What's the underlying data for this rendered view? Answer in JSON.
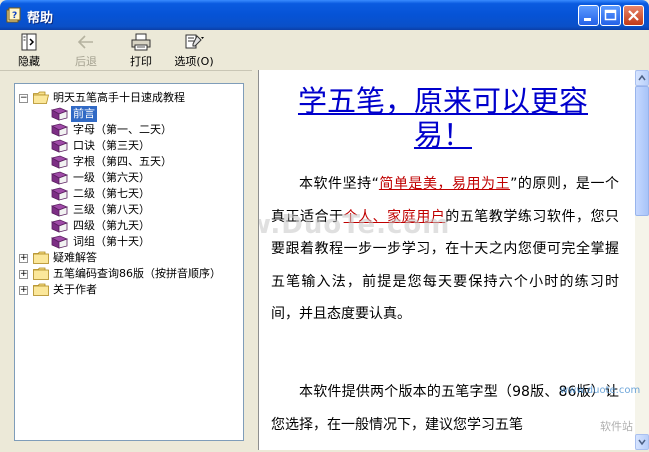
{
  "window": {
    "title": "帮助"
  },
  "toolbar": {
    "items": [
      {
        "label": "隐藏",
        "icon": "hide-pane-icon",
        "enabled": true
      },
      {
        "label": "后退",
        "icon": "back-arrow-icon",
        "enabled": false
      },
      {
        "label": "打印",
        "icon": "printer-icon",
        "enabled": true
      },
      {
        "label": "选项(O)",
        "icon": "options-icon",
        "enabled": true
      }
    ]
  },
  "tree": {
    "root": "明天五笔高手十日速成教程",
    "chapters": [
      "前言",
      "字母（第一、二天）",
      "口诀（第三天）",
      "字根（第四、五天）",
      "一级（第六天）",
      "二级（第七天）",
      "三级（第八天）",
      "四级（第九天）",
      "词组（第十天）"
    ],
    "selected": "前言",
    "others": [
      "疑难解答",
      "五笔编码查询86版（按拼音顺序）",
      "关于作者"
    ]
  },
  "content": {
    "heading_line1": "学五笔，原来可以更容",
    "heading_line2": "易！",
    "p1_a": "本软件坚持“",
    "p1_link1": "简单是美，易用为王",
    "p1_b": "”的原则，是一个真正适合于",
    "p1_link2": "个人、家庭用户",
    "p1_c": "的五笔教学练习软件，您只要跟着教程一步一步学习，在十天之内您便可完全掌握五笔输入法，前提是您每天要保持六个小时的练习时间，并且态度要认真。",
    "p2": "本软件提供两个版本的五笔字型（98版、86版）让您选择，在一般情况下，建议您学习五笔"
  },
  "watermark": {
    "main": "www.DuoTe.com",
    "corner": "www.duote.com",
    "corner2": "软件站"
  },
  "colors": {
    "title_bar": "#0653D6",
    "heading": "#0000CC",
    "link": "#C00000",
    "selection": "#316AC5"
  }
}
